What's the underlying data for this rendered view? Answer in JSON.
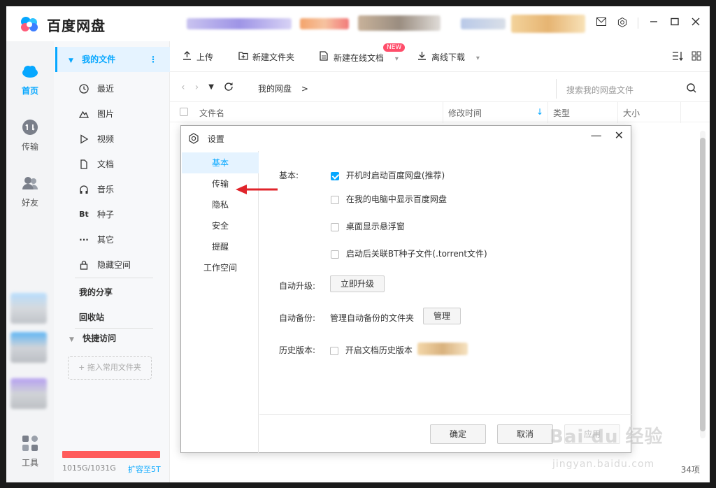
{
  "app": {
    "title": "百度网盘"
  },
  "titlebar": {
    "icons": [
      "mail-icon",
      "settings-icon",
      "minimize-icon",
      "maximize-icon",
      "close-icon"
    ]
  },
  "rail": {
    "items": [
      {
        "label": "首页",
        "icon": "home-cloud-icon",
        "active": true
      },
      {
        "label": "传输",
        "icon": "transfer-icon"
      },
      {
        "label": "好友",
        "icon": "friends-icon"
      },
      {
        "label": "工具",
        "icon": "tools-icon"
      }
    ]
  },
  "sidebar": {
    "my_files": "我的文件",
    "items": [
      {
        "label": "最近",
        "icon": "clock-icon"
      },
      {
        "label": "图片",
        "icon": "image-icon"
      },
      {
        "label": "视频",
        "icon": "play-icon"
      },
      {
        "label": "文档",
        "icon": "document-icon"
      },
      {
        "label": "音乐",
        "icon": "headphones-icon"
      },
      {
        "label": "种子",
        "icon": "bt-icon"
      },
      {
        "label": "其它",
        "icon": "more-icon"
      },
      {
        "label": "隐藏空间",
        "icon": "lock-icon"
      }
    ],
    "my_share": "我的分享",
    "recycle": "回收站",
    "quick_access": "快捷访问",
    "drag_hint": "+ 拖入常用文件夹",
    "quota_text": "1015G/1031G",
    "quota_fraction": 0.984,
    "expand_link": "扩容至5T"
  },
  "toolbar": {
    "upload": "上传",
    "new_folder": "新建文件夹",
    "new_online_doc": "新建在线文档",
    "new_badge": "NEW",
    "offline_download": "离线下载"
  },
  "pathbar": {
    "path": "我的网盘",
    "separator": ">",
    "search_placeholder": "搜索我的网盘文件"
  },
  "table": {
    "columns": [
      "文件名",
      "修改时间",
      "类型",
      "大小"
    ],
    "item_count": "34项"
  },
  "dialog": {
    "title": "设置",
    "nav": [
      "基本",
      "传输",
      "隐私",
      "安全",
      "提醒",
      "工作空间"
    ],
    "active_nav": "基本",
    "basic_label": "基本:",
    "options": [
      {
        "label": "开机时启动百度网盘(推荐)",
        "checked": true
      },
      {
        "label": "在我的电脑中显示百度网盘",
        "checked": false
      },
      {
        "label": "桌面显示悬浮窗",
        "checked": false
      },
      {
        "label": "启动后关联BT种子文件(.torrent文件)",
        "checked": false
      }
    ],
    "auto_upgrade_label": "自动升级:",
    "upgrade_button": "立即升级",
    "auto_backup_label": "自动备份:",
    "backup_desc": "管理自动备份的文件夹",
    "manage_button": "管理",
    "history_label": "历史版本:",
    "history_option": "开启文档历史版本",
    "ok": "确定",
    "cancel": "取消",
    "apply": "应用"
  },
  "watermark": {
    "main": "Bai du 经验",
    "sub": "jingyan.baidu.com"
  },
  "colors": {
    "accent": "#06a7ff",
    "quota_red": "#ff5b5b",
    "arrow_red": "#e0242b"
  }
}
